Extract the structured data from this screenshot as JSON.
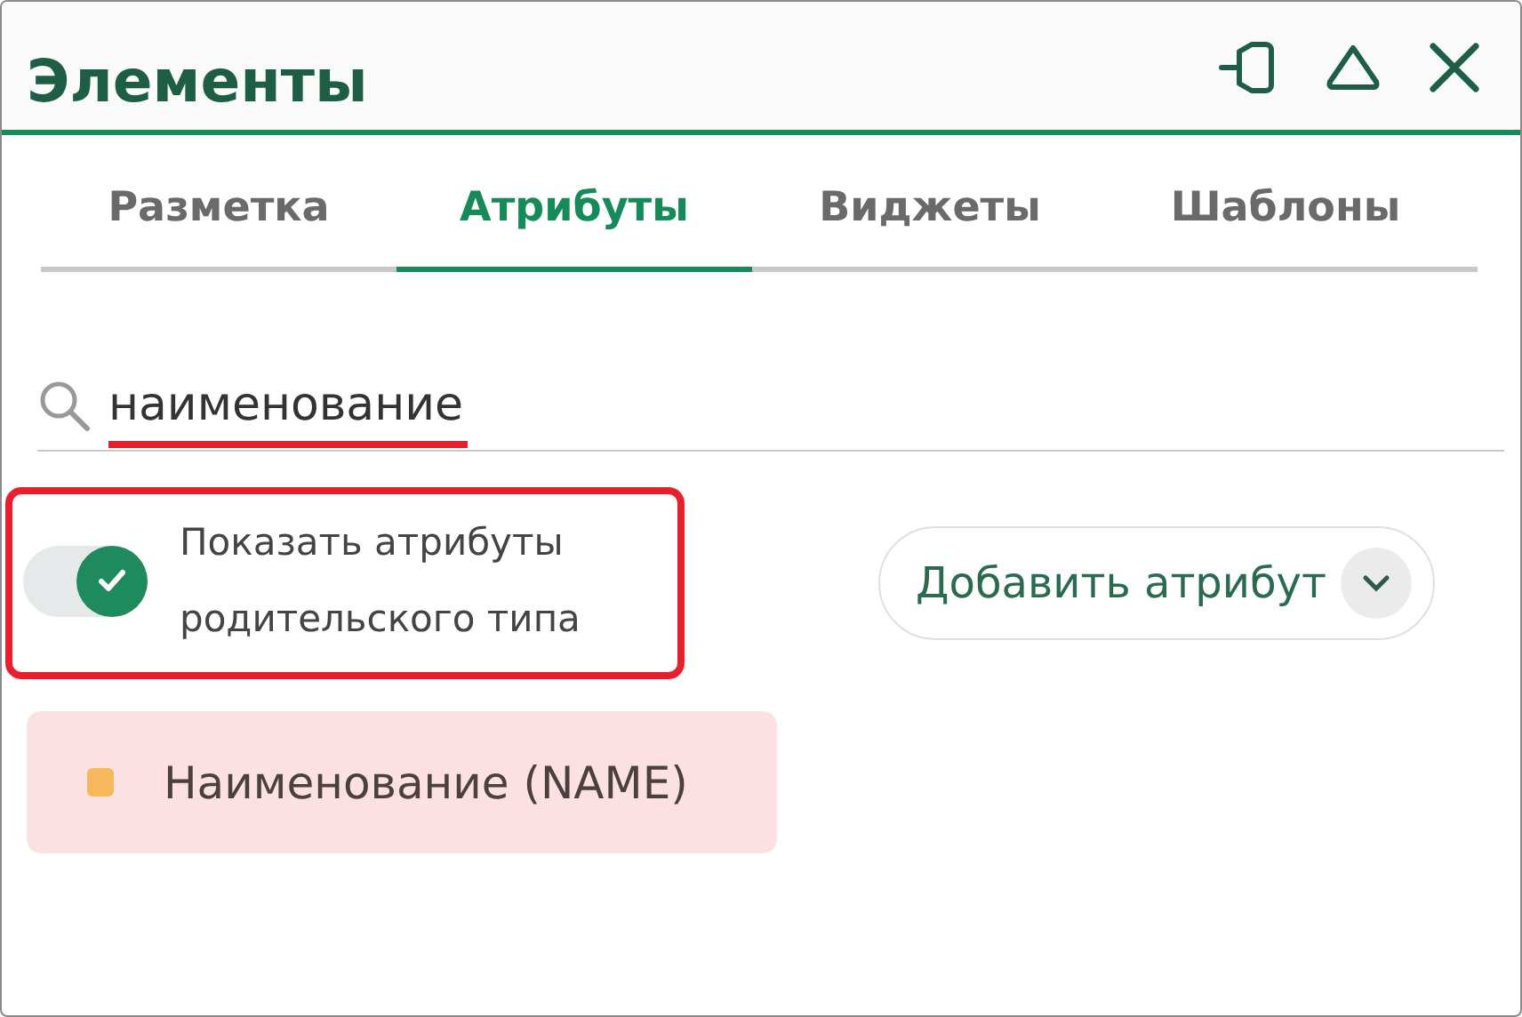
{
  "window": {
    "title": "Элементы"
  },
  "tabs": [
    {
      "label": "Разметка",
      "selected": false
    },
    {
      "label": "Атрибуты",
      "selected": true
    },
    {
      "label": "Виджеты",
      "selected": false
    },
    {
      "label": "Шаблоны",
      "selected": false
    }
  ],
  "search": {
    "value": "наименование",
    "highlighted": true
  },
  "parent_toggle": {
    "label": "Показать атрибуты родительского типа",
    "on": true,
    "highlighted": true
  },
  "add_button": {
    "label": "Добавить атрибут"
  },
  "attributes": [
    {
      "label": "Наименование (NAME)",
      "color": "#f5b85c"
    }
  ]
}
